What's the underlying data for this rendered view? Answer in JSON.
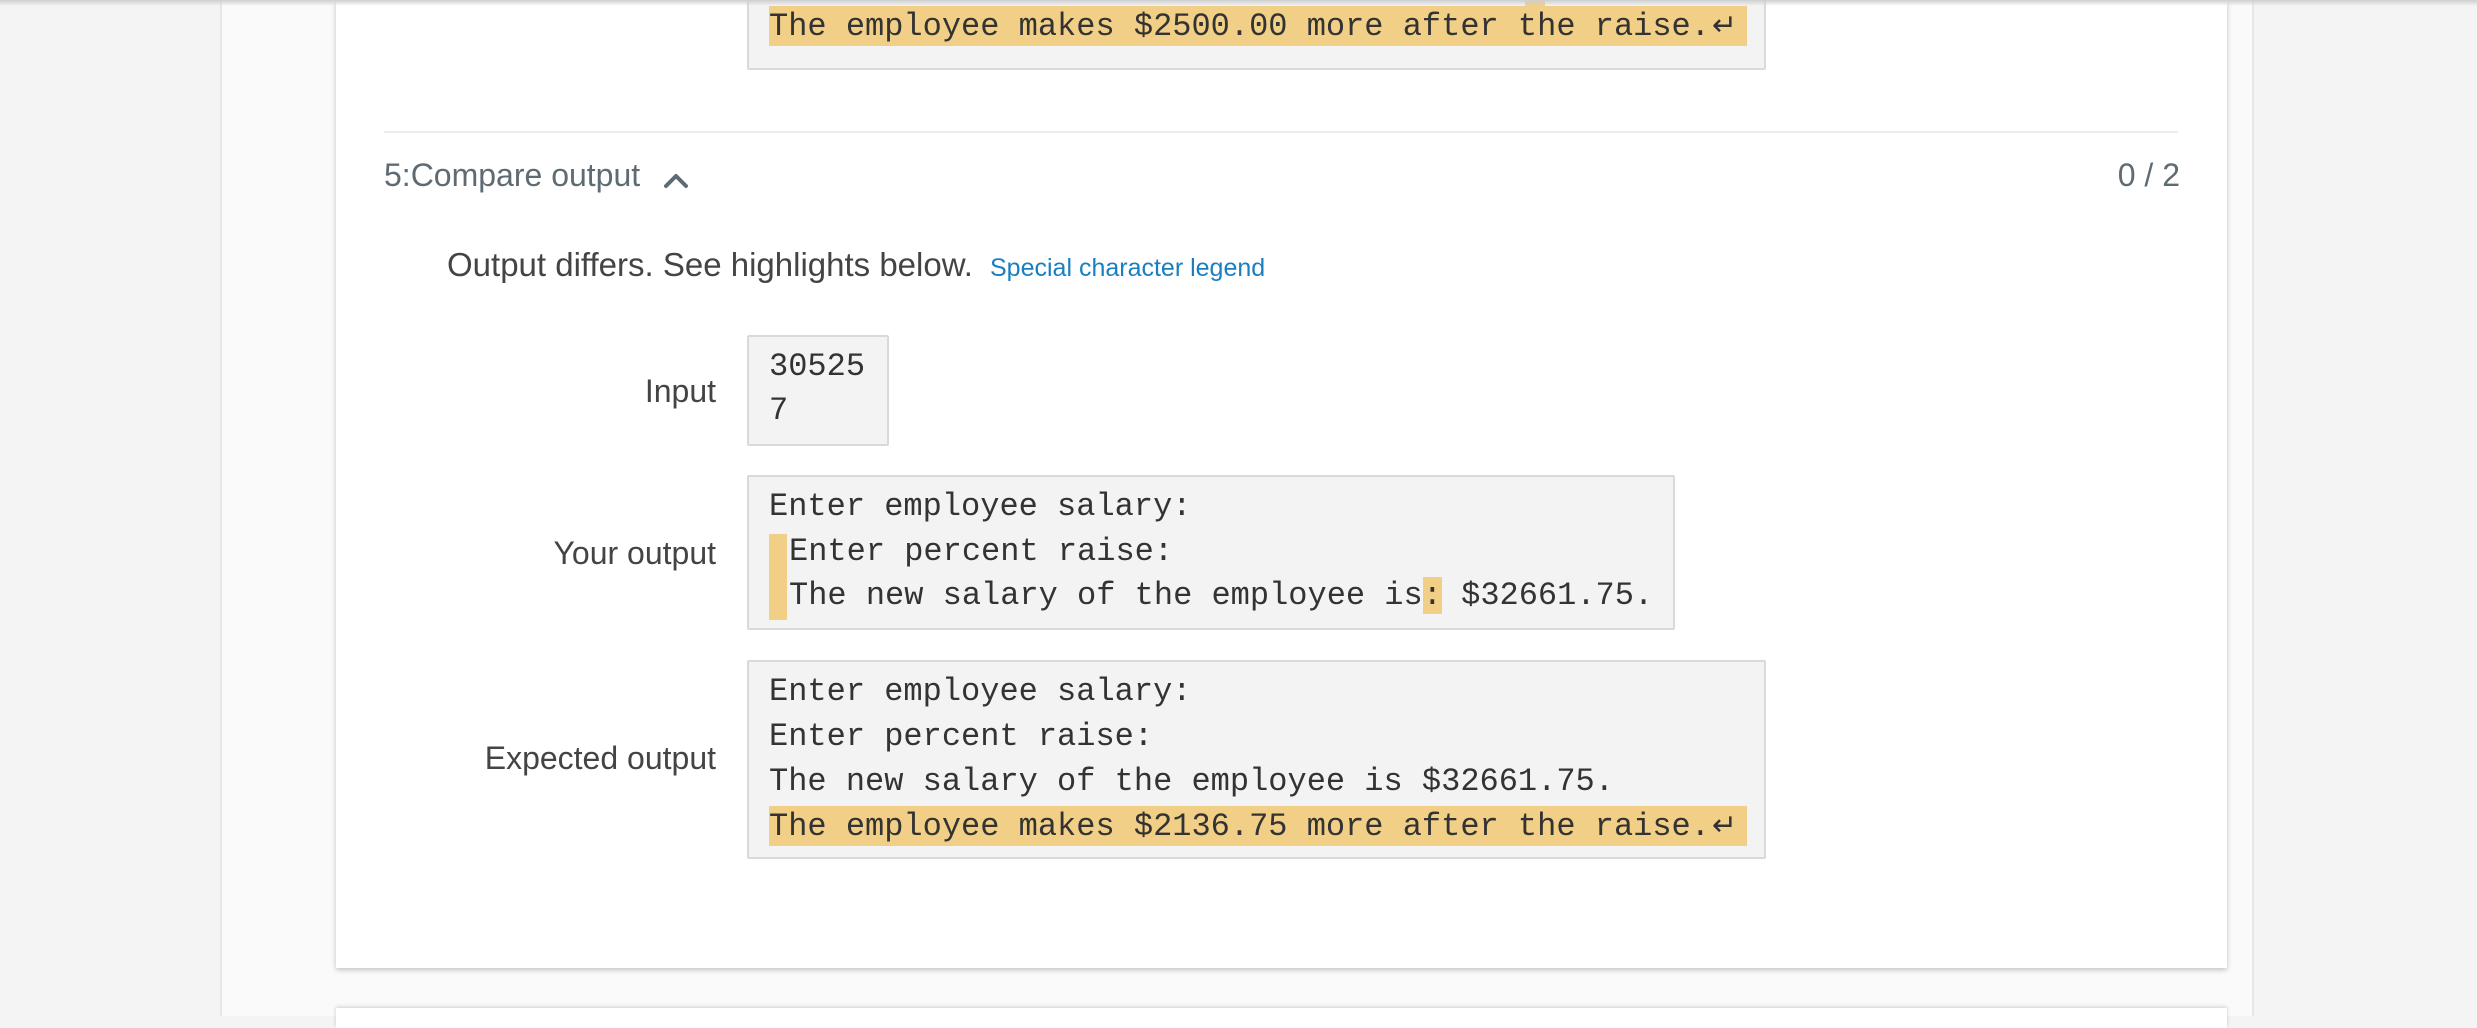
{
  "previous_test": {
    "expected_last_line": "The employee makes $2500.00 more after the raise."
  },
  "test": {
    "title": "5:Compare output",
    "score": "0 / 2",
    "status_message": "Output differs. See highlights below.",
    "legend_link": "Special character legend",
    "input_label": "Input",
    "input_lines": [
      "30525",
      "7"
    ],
    "your_output_label": "Your output",
    "your_output": {
      "line1": "Enter employee salary:",
      "line2": "Enter percent raise:",
      "line3_part1": "The new salary of the employee is",
      "line3_hl": ":",
      "line3_part2": " $32661.75."
    },
    "expected_output_label": "Expected output",
    "expected_output": {
      "line1": "Enter employee salary:",
      "line2": "Enter percent raise:",
      "line3": "The new salary of the employee is $32661.75.",
      "line4": "The employee makes $2136.75 more after the raise."
    }
  },
  "colors": {
    "highlight": "#f1cf86",
    "link": "#1a7fc1",
    "section_title": "#5f6b73"
  },
  "icons": {
    "section_toggle": "chevron-up-icon",
    "newline": "newline-return-icon"
  }
}
